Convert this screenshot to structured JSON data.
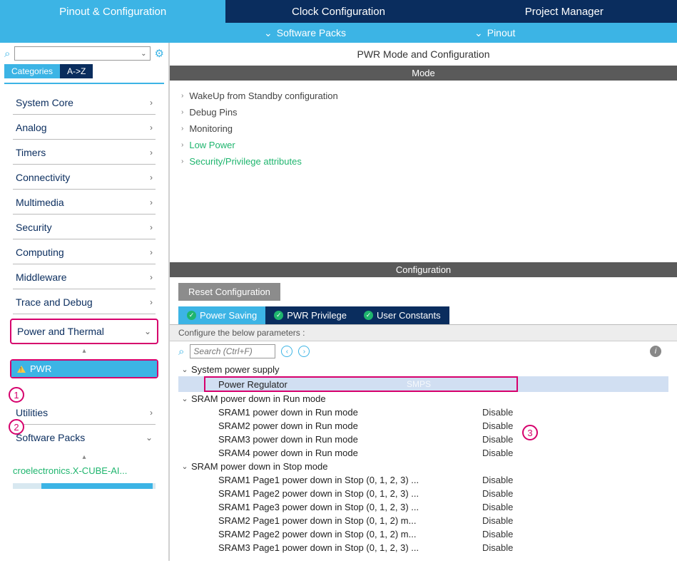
{
  "top_tabs": {
    "pinout": "Pinout & Configuration",
    "clock": "Clock Configuration",
    "project": "Project Manager"
  },
  "sub_bar": {
    "packs": "Software Packs",
    "pinout": "Pinout"
  },
  "left": {
    "filter_categories": "Categories",
    "filter_az": "A->Z",
    "cats": {
      "system_core": "System Core",
      "analog": "Analog",
      "timers": "Timers",
      "connectivity": "Connectivity",
      "multimedia": "Multimedia",
      "security": "Security",
      "computing": "Computing",
      "middleware": "Middleware",
      "trace": "Trace and Debug",
      "power_thermal": "Power and Thermal",
      "pwr": "PWR",
      "utilities": "Utilities",
      "software_packs": "Software Packs"
    },
    "pack_link": "croelectronics.X-CUBE-AI..."
  },
  "callouts": {
    "c1": "1",
    "c2": "2",
    "c3": "3"
  },
  "right": {
    "title": "PWR Mode and Configuration",
    "mode_header": "Mode",
    "modes": {
      "wakeup": "WakeUp from Standby configuration",
      "debug": "Debug Pins",
      "monitoring": "Monitoring",
      "low_power": "Low Power",
      "security": "Security/Privilege attributes"
    },
    "config_header": "Configuration",
    "reset_btn": "Reset Configuration",
    "tabs": {
      "ps": "Power Saving",
      "pp": "PWR Privilege",
      "uc": "User Constants"
    },
    "configure_hint": "Configure the below parameters :",
    "search_ph": "Search (Ctrl+F)",
    "groups": {
      "sys_supply": "System power supply",
      "pwr_reg_lbl": "Power Regulator",
      "pwr_reg_val": "SMPS",
      "sram_run": "SRAM power down in Run mode",
      "sram1_run": "SRAM1 power down in Run mode",
      "sram2_run": "SRAM2 power down in Run mode",
      "sram3_run": "SRAM3 power down in Run mode",
      "sram4_run": "SRAM4 power down in Run mode",
      "sram_stop": "SRAM power down in Stop mode",
      "s1p1": "SRAM1 Page1 power down in Stop (0, 1, 2, 3) ...",
      "s1p2": "SRAM1 Page2 power down in Stop (0, 1, 2, 3) ...",
      "s1p3": "SRAM1 Page3 power down in Stop (0, 1, 2, 3) ...",
      "s2p1": "SRAM2 Page1 power down in Stop (0, 1, 2)  m...",
      "s2p2": "SRAM2 Page2 power down in Stop (0, 1, 2)  m...",
      "s3p1": "SRAM3 Page1 power down in Stop (0, 1, 2, 3) ...",
      "disable": "Disable"
    }
  }
}
